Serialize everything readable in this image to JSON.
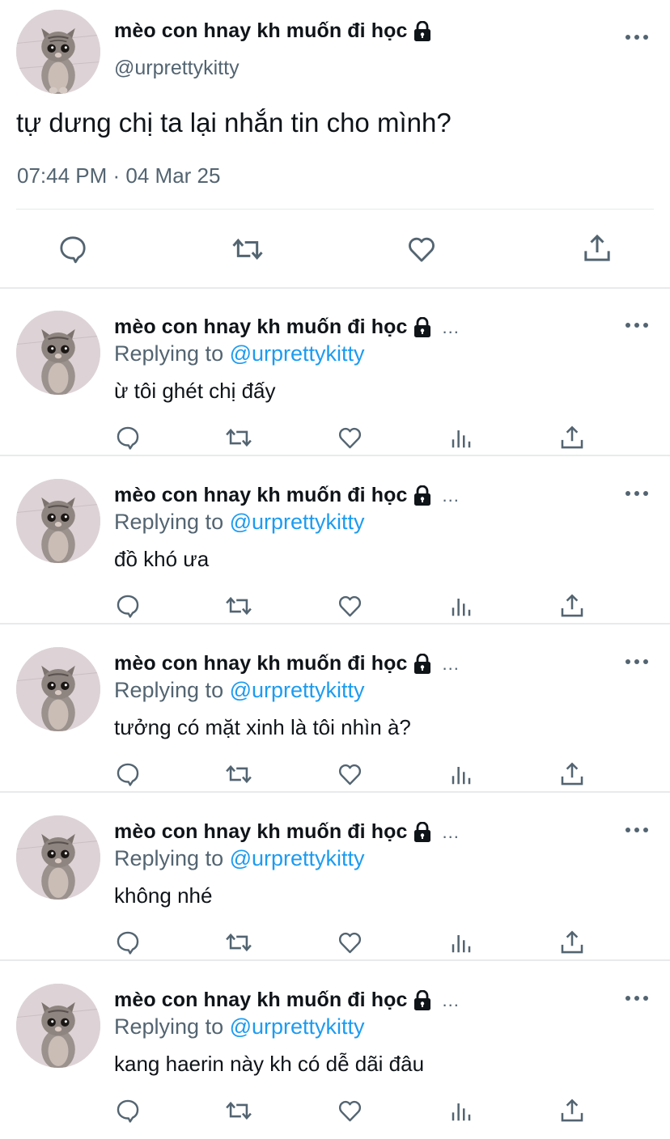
{
  "main_tweet": {
    "display_name": "mèo con hnay kh muốn đi học",
    "handle": "@urprettykitty",
    "text": "tự dưng chị ta lại nhắn tin cho mình?",
    "timestamp": "07:44 PM · 04 Mar 25",
    "icons": [
      "reply-icon",
      "retweet-icon",
      "like-icon",
      "share-icon"
    ]
  },
  "replies": [
    {
      "display_name": "mèo con hnay kh muốn đi học",
      "truncation": "...",
      "replying_prefix": "Replying to ",
      "replying_handle": "@urprettykitty",
      "text": "ừ tôi ghét chị đấy"
    },
    {
      "display_name": "mèo con hnay kh muốn đi học",
      "truncation": "...",
      "replying_prefix": "Replying to ",
      "replying_handle": "@urprettykitty",
      "text": "đồ khó ưa"
    },
    {
      "display_name": "mèo con hnay kh muốn đi học",
      "truncation": "...",
      "replying_prefix": "Replying to ",
      "replying_handle": "@urprettykitty",
      "text": "tưởng có mặt xinh là tôi nhìn à?"
    },
    {
      "display_name": "mèo con hnay kh muốn đi học",
      "truncation": "...",
      "replying_prefix": "Replying to ",
      "replying_handle": "@urprettykitty",
      "text": "không nhé"
    },
    {
      "display_name": "mèo con hnay kh muốn đi học",
      "truncation": "...",
      "replying_prefix": "Replying to ",
      "replying_handle": "@urprettykitty",
      "text": "kang haerin này kh có dễ dãi đâu"
    }
  ],
  "reply_action_icons": [
    "reply-icon",
    "retweet-icon",
    "like-icon",
    "analytics-icon",
    "share-icon"
  ],
  "colors": {
    "text": "#0f1419",
    "secondary": "#536471",
    "mention": "#1d9bf0",
    "divider": "#e8eaec"
  }
}
